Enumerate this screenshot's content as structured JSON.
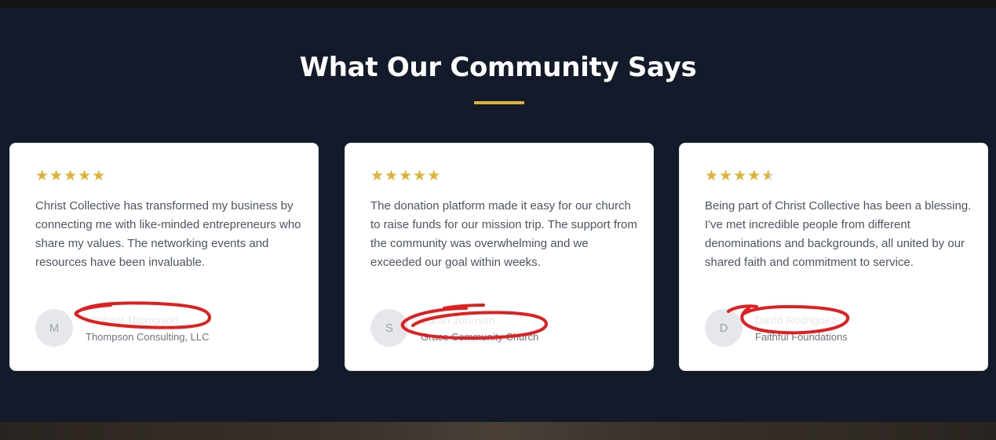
{
  "section": {
    "title": "What Our Community Says"
  },
  "accent_color": "#e0b234",
  "testimonials": [
    {
      "rating": 5,
      "stars": [
        "★",
        "★",
        "★",
        "★",
        "★"
      ],
      "quote": "Christ Collective has transformed my business by connecting me with like-minded entrepreneurs who share my values. The networking events and resources have been invaluable.",
      "avatar_initial": "M",
      "name": "Michael Thompson",
      "organization": "Thompson Consulting, LLC"
    },
    {
      "rating": 5,
      "stars": [
        "★",
        "★",
        "★",
        "★",
        "★"
      ],
      "quote": "The donation platform made it easy for our church to raise funds for our mission trip. The support from the community was overwhelming and we exceeded our goal within weeks.",
      "avatar_initial": "S",
      "name": "Sarah Johnson",
      "organization": "Grace Community Church"
    },
    {
      "rating": 4.5,
      "stars": [
        "★",
        "★",
        "★",
        "★",
        "★"
      ],
      "quote": "Being part of Christ Collective has been a blessing. I've met incredible people from different denominations and backgrounds, all united by our shared faith and commitment to service.",
      "avatar_initial": "D",
      "name": "David Rodriguez",
      "organization": "Faithful Foundations"
    }
  ],
  "icons": {
    "star": "star-icon",
    "half_star": "half-star-icon"
  }
}
